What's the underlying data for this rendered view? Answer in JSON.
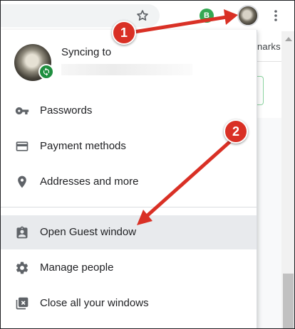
{
  "toolbar": {
    "icons": [
      "star-icon",
      "extension-icon",
      "profile-avatar",
      "kebab-menu-icon"
    ],
    "extension_letter": "B",
    "bg_bookmarks_label": "narks"
  },
  "profile_menu": {
    "sync_label": "Syncing to",
    "items": [
      {
        "label": "Passwords",
        "icon": "key-icon"
      },
      {
        "label": "Payment methods",
        "icon": "credit-card-icon"
      },
      {
        "label": "Addresses and more",
        "icon": "location-pin-icon"
      },
      {
        "label": "Open Guest window",
        "icon": "guest-badge-icon"
      },
      {
        "label": "Manage people",
        "icon": "gear-icon"
      },
      {
        "label": "Close all your windows",
        "icon": "close-windows-icon"
      }
    ]
  },
  "annotations": {
    "step_1": "1",
    "step_2": "2"
  },
  "colors": {
    "annotation_red": "#d93025",
    "sync_green": "#1e8e3e",
    "hover_row": "#e8eaed",
    "icon_gray": "#5f6368"
  }
}
